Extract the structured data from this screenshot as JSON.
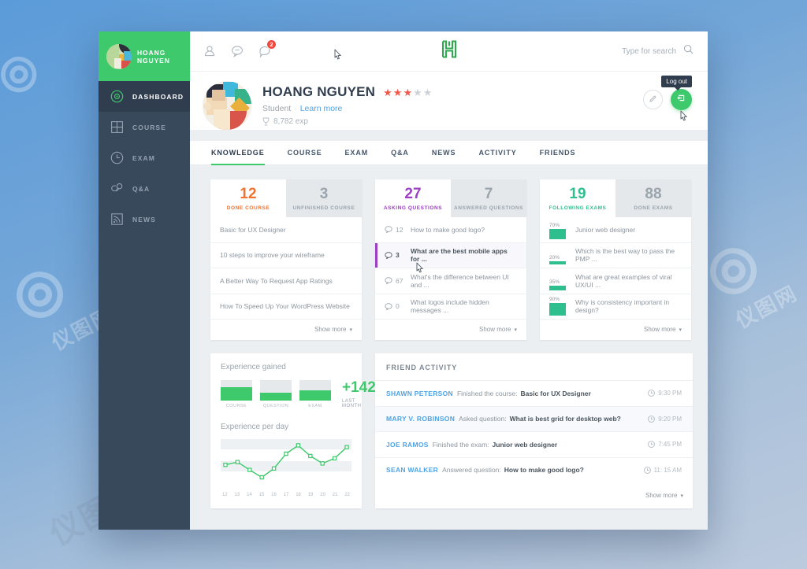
{
  "sidebar": {
    "brand_name": "HOANG NGUYEN",
    "brand_logo_icon": "app-logo-circle",
    "items": [
      {
        "label": "DASHBOARD",
        "icon": "dashboard-icon",
        "active": true
      },
      {
        "label": "COURSE",
        "icon": "grid-icon",
        "active": false
      },
      {
        "label": "EXAM",
        "icon": "clock-icon",
        "active": false
      },
      {
        "label": "Q&A",
        "icon": "chat-bubbles-icon",
        "active": false
      },
      {
        "label": "NEWS",
        "icon": "rss-icon",
        "active": false
      }
    ]
  },
  "topbar": {
    "icons": [
      {
        "name": "user-icon",
        "badge": ""
      },
      {
        "name": "message-icon",
        "badge": ""
      },
      {
        "name": "notification-icon",
        "badge": "2"
      }
    ],
    "logo_text": "H",
    "search": {
      "placeholder": "Type for search",
      "value": "",
      "icon": "search-icon"
    }
  },
  "profile": {
    "name": "HOANG NGUYEN",
    "rating": 3,
    "rating_max": 5,
    "role": "Student",
    "separator": "·",
    "learn_more": "Learn more",
    "exp": "8,782 exp",
    "exp_icon": "trophy-icon",
    "edit_icon": "pencil-icon",
    "logout_icon": "logout-icon",
    "logout_tooltip": "Log out",
    "tabs": [
      {
        "label": "KNOWLEDGE",
        "active": true
      },
      {
        "label": "COURSE",
        "active": false
      },
      {
        "label": "EXAM",
        "active": false
      },
      {
        "label": "Q&A",
        "active": false
      },
      {
        "label": "NEWS",
        "active": false
      },
      {
        "label": "ACTIVITY",
        "active": false
      },
      {
        "label": "FRIENDS",
        "active": false
      }
    ]
  },
  "course_card": {
    "tabs": [
      {
        "number": "12",
        "label": "DONE COURSE",
        "active": true,
        "color": "#ef7333"
      },
      {
        "number": "3",
        "label": "UNFINISHED COURSE",
        "active": false,
        "color": "#9aa4ad"
      }
    ],
    "items": [
      {
        "title": "Basic for UX Designer"
      },
      {
        "title": "10 steps to improve your wireframe"
      },
      {
        "title": "A Better Way To Request App Ratings"
      },
      {
        "title": "How To Speed Up Your WordPress Website"
      }
    ],
    "show_more": "Show more"
  },
  "question_card": {
    "tabs": [
      {
        "number": "27",
        "label": "ASKING QUESTIONS",
        "active": true,
        "color": "#9c3fc4"
      },
      {
        "number": "7",
        "label": "ANSWERED QUESTIONS",
        "active": false,
        "color": "#9aa4ad"
      }
    ],
    "items": [
      {
        "count": "12",
        "title": "How to make good logo?",
        "selected": false
      },
      {
        "count": "3",
        "title": "What are the best mobile apps for ...",
        "selected": true
      },
      {
        "count": "67",
        "title": "What's the difference between UI and ...",
        "selected": false
      },
      {
        "count": "0",
        "title": "What logos include hidden messages ...",
        "selected": false
      }
    ],
    "show_more": "Show more"
  },
  "exam_card": {
    "tabs": [
      {
        "number": "19",
        "label": "FOLLOWING EXAMS",
        "active": true,
        "color": "#2fbf8f"
      },
      {
        "number": "88",
        "label": "DONE EXAMS",
        "active": false,
        "color": "#9aa4ad"
      }
    ],
    "items": [
      {
        "pct": "70%",
        "pct_value": 70,
        "title": "Junior web designer"
      },
      {
        "pct": "20%",
        "pct_value": 20,
        "title": "Which is the best way to pass the PMP ..."
      },
      {
        "pct": "35%",
        "pct_value": 35,
        "title": "What are great examples of viral UX/UI ..."
      },
      {
        "pct": "90%",
        "pct_value": 90,
        "title": "Why is consistency important in design?"
      }
    ],
    "show_more": "Show more"
  },
  "experience": {
    "gained_title": "Experience gained",
    "per_day_title": "Experience per day",
    "bars": [
      {
        "label": "COURSE",
        "value": 65
      },
      {
        "label": "QUESTION",
        "value": 40
      },
      {
        "label": "EXAM",
        "value": 50
      }
    ],
    "total": "+142",
    "total_label": "LAST MONTH"
  },
  "chart_data": {
    "type": "line",
    "title": "Experience per day",
    "xlabel": "",
    "ylabel": "",
    "categories": [
      "12",
      "13",
      "14",
      "15",
      "16",
      "17",
      "18",
      "19",
      "20",
      "21",
      "22"
    ],
    "values": [
      38,
      44,
      27,
      11,
      30,
      62,
      80,
      57,
      41,
      52,
      76
    ],
    "ylim": [
      0,
      90
    ],
    "grid": true,
    "legend": "none",
    "series_color": "#3ec96c"
  },
  "friend_activity": {
    "title": "FRIEND ACTIVITY",
    "rows": [
      {
        "user": "SHAWN PETERSON",
        "action": "Finished the course:",
        "object": "Basic for UX Designer",
        "time": "9:30 PM",
        "highlight": false
      },
      {
        "user": "MARY V. ROBINSON",
        "action": "Asked question:",
        "object": "What is best grid for desktop web?",
        "time": "9:20 PM",
        "highlight": true
      },
      {
        "user": "JOE RAMOS",
        "action": "Finished the exam:",
        "object": "Junior web designer",
        "time": "7:45 PM",
        "highlight": false
      },
      {
        "user": "SEAN WALKER",
        "action": "Answered question:",
        "object": "How to make good logo?",
        "time": "11: 15 AM",
        "highlight": false
      }
    ],
    "show_more": "Show more",
    "clock_icon": "clock-icon"
  },
  "colors": {
    "brand_green": "#3ec96c",
    "sidebar": "#39495c",
    "orange": "#ef7333",
    "purple": "#9c3fc4",
    "teal": "#2fbf8f",
    "link_blue": "#4fa3e3",
    "badge_red": "#f0493e"
  }
}
